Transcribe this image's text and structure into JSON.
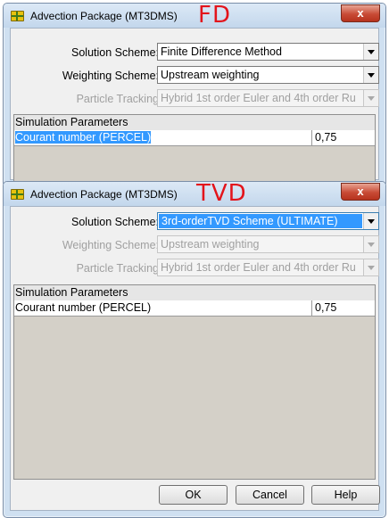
{
  "fd_window": {
    "title": "Advection Package (MT3DMS)",
    "tag": "FD",
    "close_label": "x",
    "solution_scheme": {
      "label": "Solution Scheme:",
      "value": "Finite Difference Method"
    },
    "weighting_scheme": {
      "label": "Weighting Scheme:",
      "value": "Upstream weighting"
    },
    "particle_tracking": {
      "label": "Particle Tracking",
      "value": "Hybrid 1st order Euler and 4th order Ru"
    },
    "params": {
      "header": "Simulation Parameters",
      "rows": [
        {
          "name": "Courant number (PERCEL)",
          "value": "0,75"
        }
      ]
    }
  },
  "tvd_window": {
    "title": "Advection Package (MT3DMS)",
    "tag": "TVD",
    "close_label": "x",
    "solution_scheme": {
      "label": "Solution Scheme:",
      "value": "3rd-orderTVD Scheme (ULTIMATE)"
    },
    "weighting_scheme": {
      "label": "Weighting Scheme:",
      "value": "Upstream weighting"
    },
    "particle_tracking": {
      "label": "Particle Tracking",
      "value": "Hybrid 1st order Euler and 4th order Ru"
    },
    "params": {
      "header": "Simulation Parameters",
      "rows": [
        {
          "name": "Courant number (PERCEL)",
          "value": "0,75"
        }
      ]
    },
    "buttons": {
      "ok": "OK",
      "cancel": "Cancel",
      "help": "Help"
    }
  }
}
